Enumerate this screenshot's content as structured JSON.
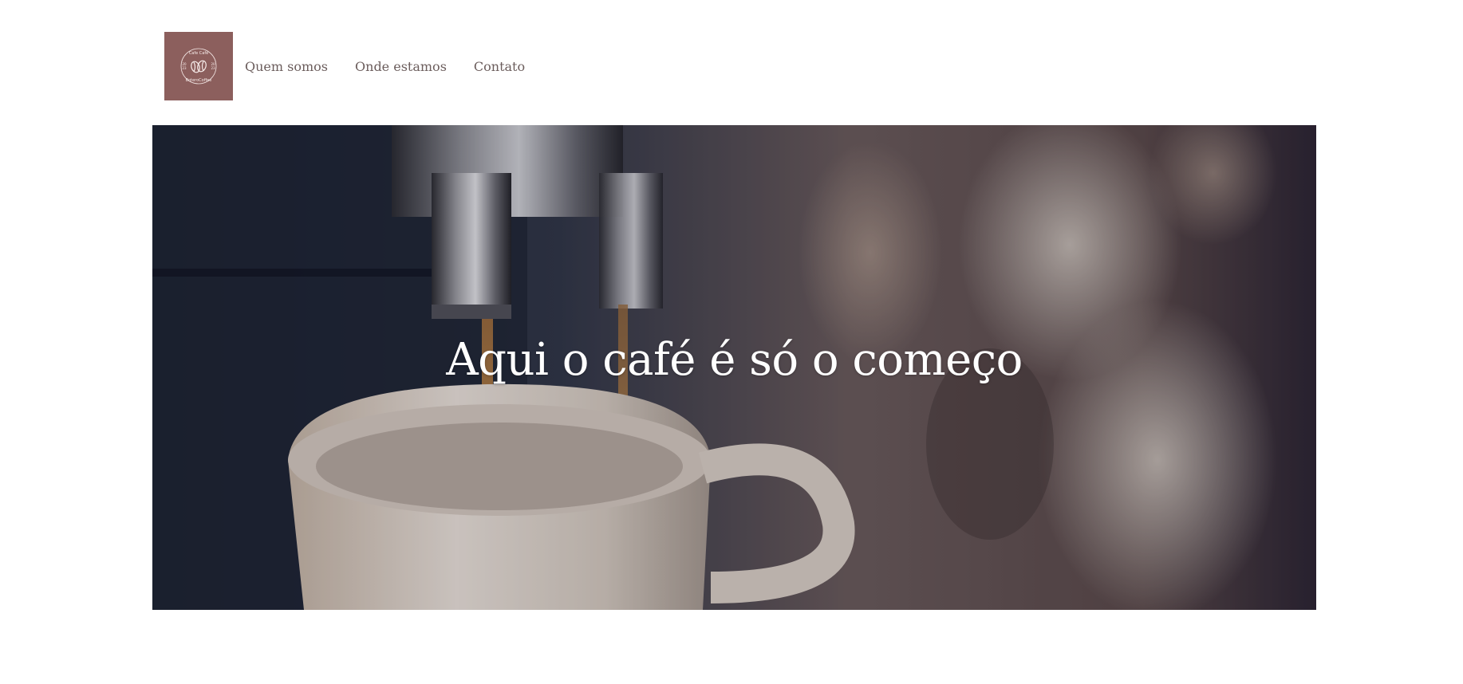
{
  "header": {
    "logo": {
      "alt": "Cafe Café BoteroCoffee",
      "ring_text_top": "Cafe Café",
      "ring_text_bottom": "BoteroCoffee",
      "left_mark": "20\n23",
      "right_mark": "20\n23",
      "background_color": "#8c5f5d",
      "icon": "coffee-beans-icon"
    },
    "nav": [
      {
        "label": "Quem somos"
      },
      {
        "label": "Onde estamos"
      },
      {
        "label": "Contato"
      }
    ]
  },
  "hero": {
    "title": "Aqui o café é só o começo",
    "image": "espresso-machine-pouring-into-white-cup"
  },
  "colors": {
    "nav_text": "#6b5d5c",
    "hero_text": "#ffffff"
  }
}
